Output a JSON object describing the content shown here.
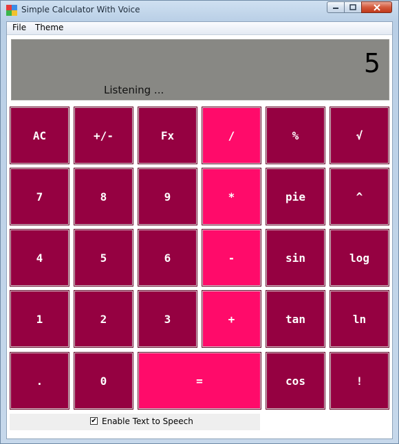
{
  "window": {
    "title": "Simple Calculator With Voice",
    "controls": {
      "minimize": "minimize",
      "maximize": "maximize",
      "close": "close"
    }
  },
  "menu": [
    {
      "label": "File"
    },
    {
      "label": "Theme"
    }
  ],
  "display": {
    "value": "5",
    "status": "Listening ..."
  },
  "keys": [
    {
      "label": "AC"
    },
    {
      "label": "+/-"
    },
    {
      "label": "Fx"
    },
    {
      "label": "/"
    },
    {
      "label": "%"
    },
    {
      "label": "√"
    },
    {
      "label": "7"
    },
    {
      "label": "8"
    },
    {
      "label": "9"
    },
    {
      "label": "*"
    },
    {
      "label": "pie"
    },
    {
      "label": "^"
    },
    {
      "label": "4"
    },
    {
      "label": "5"
    },
    {
      "label": "6"
    },
    {
      "label": "-"
    },
    {
      "label": "sin"
    },
    {
      "label": "log"
    },
    {
      "label": "1"
    },
    {
      "label": "2"
    },
    {
      "label": "3"
    },
    {
      "label": "+"
    },
    {
      "label": "tan"
    },
    {
      "label": "ln"
    },
    {
      "label": "."
    },
    {
      "label": "0"
    },
    {
      "label": "="
    },
    {
      "label": "cos"
    },
    {
      "label": "!"
    }
  ],
  "speech": {
    "label": "Enable Text to Speech",
    "checked": true
  },
  "colors": {
    "key_dark": "#950141",
    "key_accent": "#ff0b6a",
    "display_bg": "#888884"
  }
}
